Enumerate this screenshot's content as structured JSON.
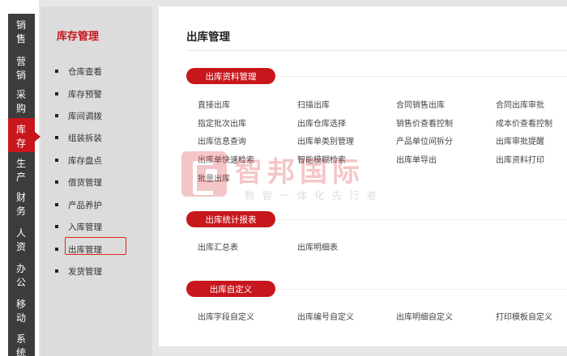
{
  "modules": [
    {
      "top": "销",
      "bottom": "售"
    },
    {
      "top": "营",
      "bottom": "销"
    },
    {
      "top": "采",
      "bottom": "购"
    },
    {
      "top": "库",
      "bottom": "存"
    },
    {
      "top": "生",
      "bottom": "产"
    },
    {
      "top": "财",
      "bottom": "务"
    },
    {
      "top": "人",
      "bottom": "资"
    },
    {
      "top": "办",
      "bottom": "公"
    },
    {
      "top": "移",
      "bottom": "动"
    },
    {
      "top": "系",
      "bottom": "统"
    }
  ],
  "submenu": {
    "title": "库存管理",
    "items": [
      "仓库查看",
      "库存预警",
      "库间调拨",
      "组装拆装",
      "库存盘点",
      "借货管理",
      "产品养护",
      "入库管理",
      "出库管理",
      "发货管理"
    ]
  },
  "main": {
    "title": "出库管理",
    "sections": [
      {
        "label": "出库资料管理",
        "rows": [
          [
            "直接出库",
            "扫描出库",
            "合同销售出库",
            "合同出库审批"
          ],
          [
            "指定批次出库",
            "出库仓库选择",
            "销售价查看控制",
            "成本价查看控制"
          ],
          [
            "出库信息查询",
            "出库单类别管理",
            "产品单位间拆分",
            "出库审批提醒"
          ],
          [
            "出库单快速检索",
            "智能模糊检索",
            "出库单导出",
            "出库资料打印"
          ],
          [
            "批量出库"
          ]
        ]
      },
      {
        "label": "出库统计报表",
        "rows": [
          [
            "出库汇总表",
            "出库明细表"
          ]
        ]
      },
      {
        "label": "出库自定义",
        "rows": [
          [
            "出库字段自定义",
            "出库编号自定义",
            "出库明细自定义",
            "打印模板自定义"
          ]
        ]
      }
    ]
  },
  "watermark": {
    "name": "智邦国际",
    "slogan": "数智一体化先行者"
  },
  "colors": {
    "accent": "#c8161d",
    "nav_dark": "#3c3c3c"
  }
}
